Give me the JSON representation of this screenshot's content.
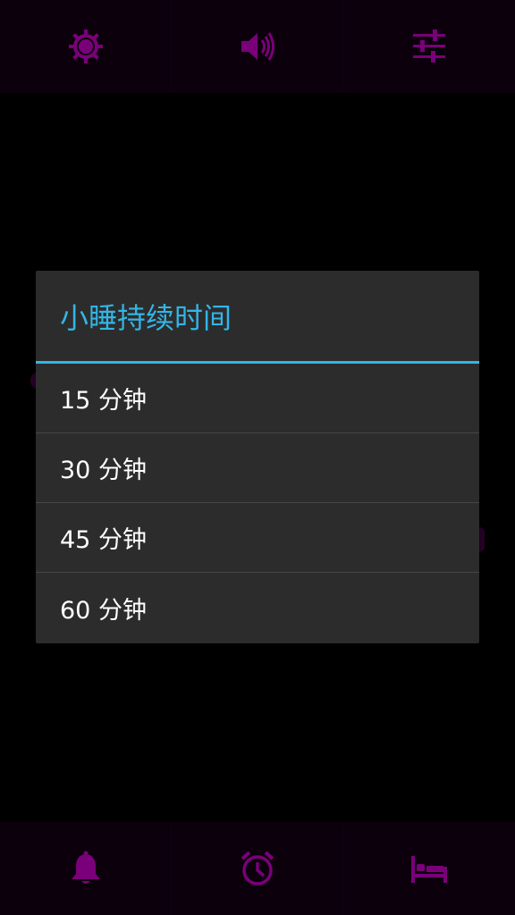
{
  "colors": {
    "accent": "#33b5e5",
    "icon": "#7a007a",
    "dialog_bg": "#2c2c2c",
    "screen_bg": "#000000"
  },
  "top_bar": {
    "buttons": [
      {
        "icon": "brightness-icon"
      },
      {
        "icon": "volume-icon"
      },
      {
        "icon": "settings-sliders-icon"
      }
    ]
  },
  "dialog": {
    "title": "小睡持续时间",
    "options": [
      {
        "label": "15 分钟"
      },
      {
        "label": "30 分钟"
      },
      {
        "label": "45 分钟"
      },
      {
        "label": "60 分钟"
      }
    ]
  },
  "bottom_bar": {
    "buttons": [
      {
        "icon": "bell-icon"
      },
      {
        "icon": "alarm-clock-icon"
      },
      {
        "icon": "bed-icon"
      }
    ]
  }
}
